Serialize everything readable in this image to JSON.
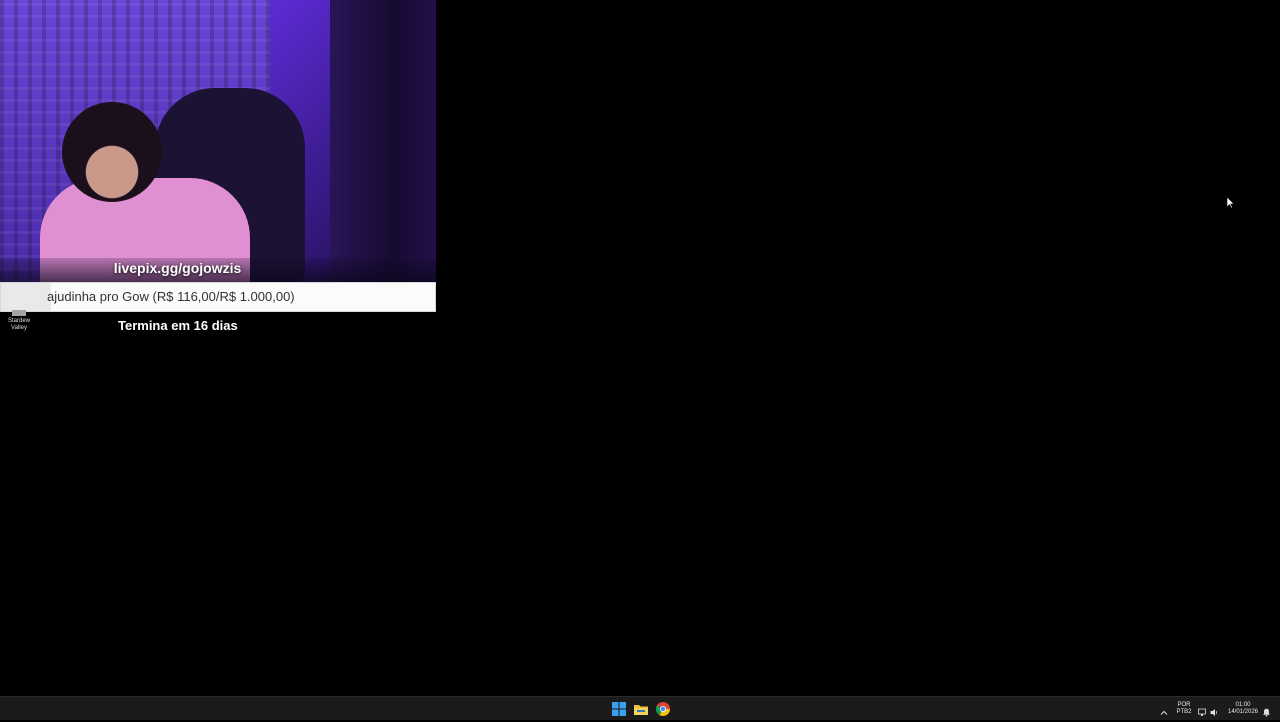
{
  "stream_overlay": {
    "livepix_url": "livepix.gg/gojowzis",
    "goal": {
      "text": "ajudinha pro Gow (R$ 116,00/R$ 1.000,00)",
      "progress_fraction": 0.116
    },
    "deadline": "Termina em 16 dias"
  },
  "desktop": {
    "icon_label": "Stardew Valley"
  },
  "taskbar": {
    "language_line1": "POR",
    "language_line2": "PTB2",
    "time": "01:00",
    "date": "14/01/2026",
    "icons": [
      "windows-start-icon",
      "file-explorer-icon",
      "chrome-icon"
    ]
  }
}
